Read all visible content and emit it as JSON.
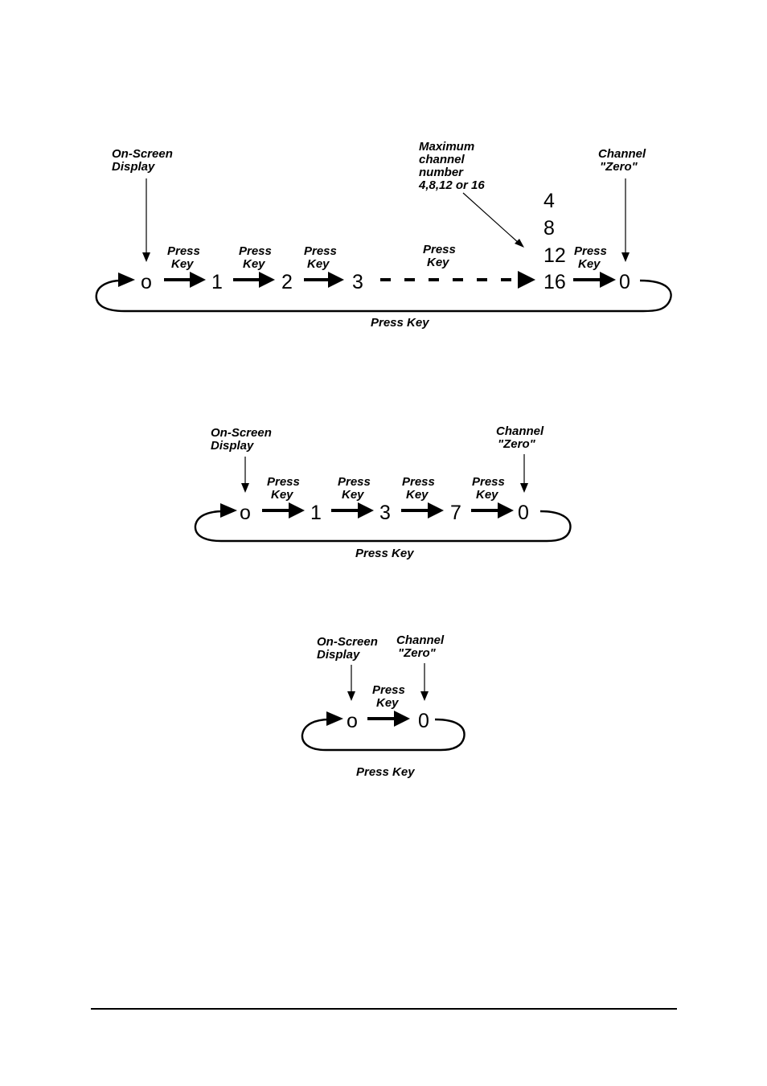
{
  "diagram1": {
    "display_label": [
      "On-Screen",
      "Display"
    ],
    "max_label": [
      "Maximum",
      "channel",
      "number",
      "4,8,12 or 16"
    ],
    "zero_label": [
      "Channel",
      "\"Zero\""
    ],
    "start": "o",
    "states": [
      "1",
      "2",
      "3"
    ],
    "max_options": [
      "4",
      "8",
      "12",
      "16"
    ],
    "end": "0",
    "step_label": [
      "Press",
      "Key"
    ],
    "loop_label": "Press Key"
  },
  "diagram2": {
    "display_label": [
      "On-Screen",
      "Display"
    ],
    "zero_label": [
      "Channel",
      "\"Zero\""
    ],
    "start": "o",
    "states": [
      "1",
      "3",
      "7"
    ],
    "end": "0",
    "step_label": [
      "Press",
      "Key"
    ],
    "loop_label": "Press Key"
  },
  "diagram3": {
    "display_label": [
      "On-Screen",
      "Display"
    ],
    "zero_label": [
      "Channel",
      "\"Zero\""
    ],
    "start": "o",
    "end": "0",
    "step_label": [
      "Press",
      "Key"
    ],
    "loop_label": "Press Key"
  }
}
